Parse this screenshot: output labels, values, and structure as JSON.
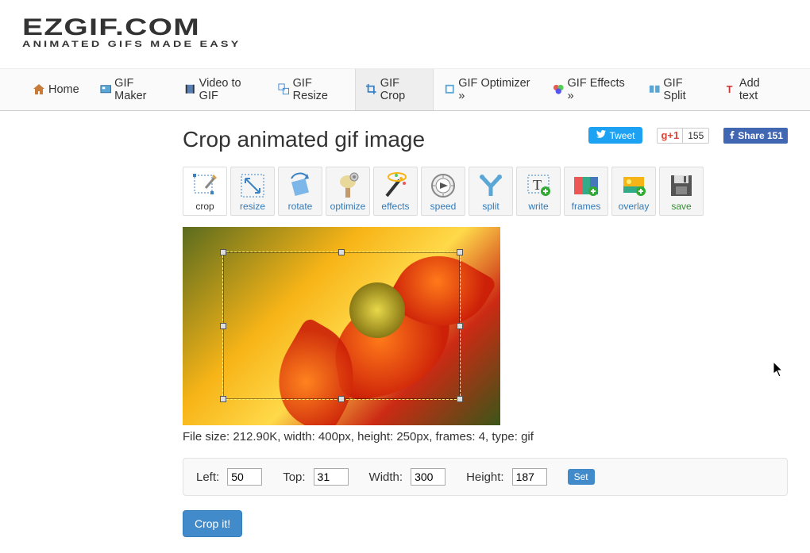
{
  "logo": {
    "main": "EZGIF.COM",
    "sub": "ANIMATED GIFS MADE EASY"
  },
  "nav": {
    "home": "Home",
    "gifmaker": "GIF Maker",
    "video2gif": "Video to GIF",
    "resize": "GIF Resize",
    "crop": "GIF Crop",
    "optimizer": "GIF Optimizer »",
    "effects": "GIF Effects »",
    "split": "GIF Split",
    "addtext": "Add text"
  },
  "share": {
    "tweet": "Tweet",
    "gplus_label": "+1",
    "gplus_count": "155",
    "fb": "Share 151"
  },
  "title": "Crop animated gif image",
  "tools": {
    "crop": "crop",
    "resize": "resize",
    "rotate": "rotate",
    "optimize": "optimize",
    "effects": "effects",
    "speed": "speed",
    "split": "split",
    "write": "write",
    "frames": "frames",
    "overlay": "overlay",
    "save": "save"
  },
  "fileinfo": "File size: 212.90K, width: 400px, height: 250px, frames: 4, type: gif",
  "params": {
    "left_label": "Left:",
    "left": "50",
    "top_label": "Top:",
    "top": "31",
    "width_label": "Width:",
    "width": "300",
    "height_label": "Height:",
    "height": "187",
    "set": "Set"
  },
  "cropit": "Crop it!",
  "colors": {
    "accent": "#428bca",
    "twitter": "#1da1f2",
    "fb": "#4267B2",
    "gplus": "#db4437"
  }
}
